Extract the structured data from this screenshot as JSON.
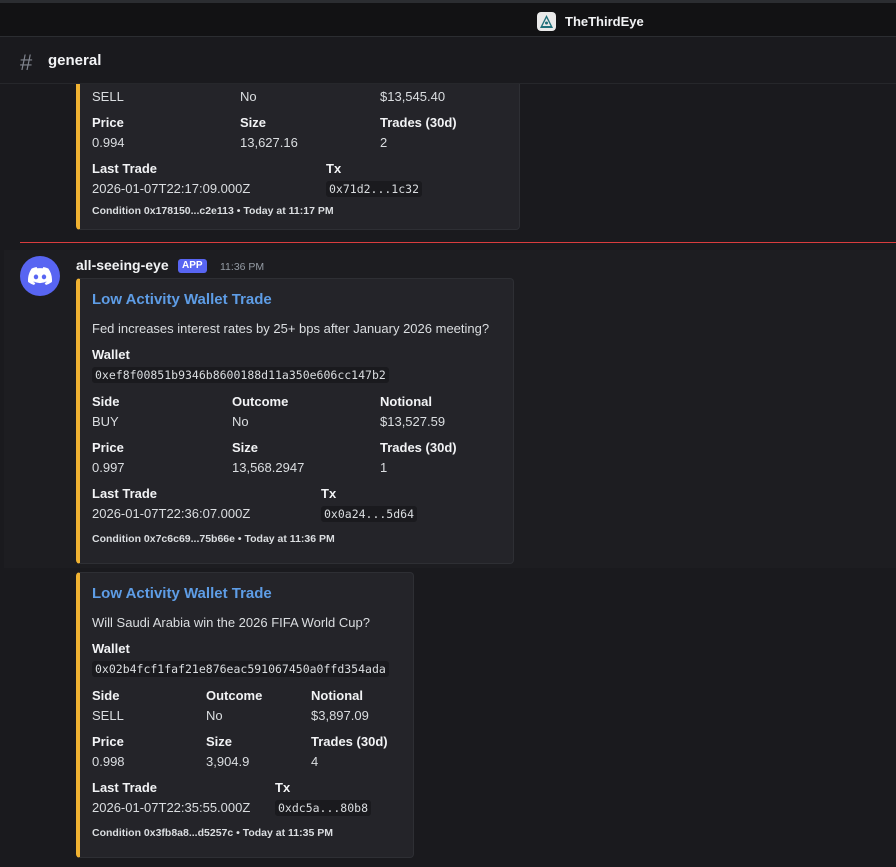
{
  "server": {
    "name": "TheThirdEye",
    "logo_icon": "eye-pyramid-icon"
  },
  "channel": {
    "name": "general",
    "icon": "hash-icon"
  },
  "new_messages_divider_color": "#d83c3e",
  "embed_accent_color": "#f0b232",
  "partial_embed": {
    "side_value": "SELL",
    "outcome_value": "No",
    "notional_value": "$13,545.40",
    "price_label": "Price",
    "price_value": "0.994",
    "size_label": "Size",
    "size_value": "13,627.16",
    "trades_label": "Trades (30d)",
    "trades_value": "2",
    "last_trade_label": "Last Trade",
    "last_trade_value": "2026-01-07T22:17:09.000Z",
    "tx_label": "Tx",
    "tx_value": "0x71d2...1c32",
    "footer": "Condition 0x178150...c2e113 • Today at 11:17 PM"
  },
  "message": {
    "author": "all-seeing-eye",
    "badge": "APP",
    "time": "11:36 PM",
    "avatar_icon": "discord-logo-icon"
  },
  "embeds": [
    {
      "title": "Low Activity Wallet Trade",
      "question": "Fed increases interest rates by 25+ bps after January 2026 meeting?",
      "wallet_label": "Wallet",
      "wallet": "0xef8f00851b9346b8600188d11a350e606cc147b2",
      "side_label": "Side",
      "side": "BUY",
      "outcome_label": "Outcome",
      "outcome": "No",
      "notional_label": "Notional",
      "notional": "$13,527.59",
      "price_label": "Price",
      "price": "0.997",
      "size_label": "Size",
      "size": "13,568.2947",
      "trades_label": "Trades (30d)",
      "trades": "1",
      "last_trade_label": "Last Trade",
      "last_trade": "2026-01-07T22:36:07.000Z",
      "tx_label": "Tx",
      "tx": "0x0a24...5d64",
      "footer": "Condition 0x7c6c69...75b66e • Today at 11:36 PM"
    },
    {
      "title": "Low Activity Wallet Trade",
      "question": "Will Saudi Arabia win the 2026 FIFA World Cup?",
      "wallet_label": "Wallet",
      "wallet": "0x02b4fcf1faf21e876eac591067450a0ffd354ada",
      "side_label": "Side",
      "side": "SELL",
      "outcome_label": "Outcome",
      "outcome": "No",
      "notional_label": "Notional",
      "notional": "$3,897.09",
      "price_label": "Price",
      "price": "0.998",
      "size_label": "Size",
      "size": "3,904.9",
      "trades_label": "Trades (30d)",
      "trades": "4",
      "last_trade_label": "Last Trade",
      "last_trade": "2026-01-07T22:35:55.000Z",
      "tx_label": "Tx",
      "tx": "0xdc5a...80b8",
      "footer": "Condition 0x3fb8a8...d5257c • Today at 11:35 PM"
    }
  ]
}
